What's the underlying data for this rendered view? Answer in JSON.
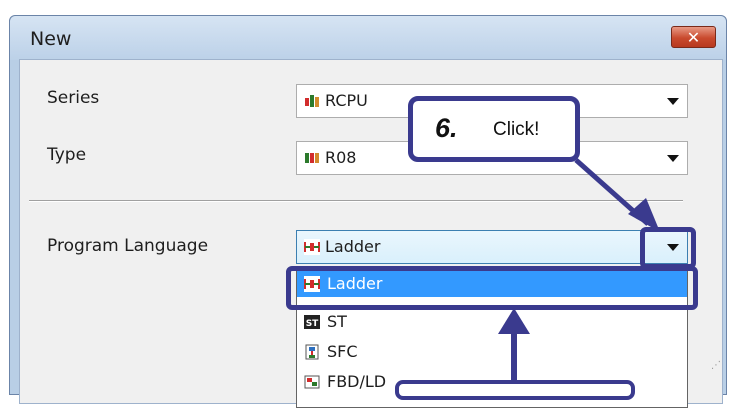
{
  "dialog": {
    "title": "New",
    "close_label": "✕"
  },
  "fields": {
    "series": {
      "label": "Series",
      "value": "RCPU"
    },
    "type": {
      "label": "Type",
      "value": "R08"
    },
    "program_language": {
      "label": "Program Language",
      "value": "Ladder"
    }
  },
  "dropdown": {
    "options": [
      {
        "label": "Ladder",
        "selected": true
      },
      {
        "label": "ST"
      },
      {
        "label": "SFC"
      },
      {
        "label": "FBD/LD"
      }
    ]
  },
  "callout": {
    "step": "6.",
    "text": "Click!"
  },
  "colors": {
    "annotation": "#3a3a8e",
    "selection": "#3399ff"
  }
}
